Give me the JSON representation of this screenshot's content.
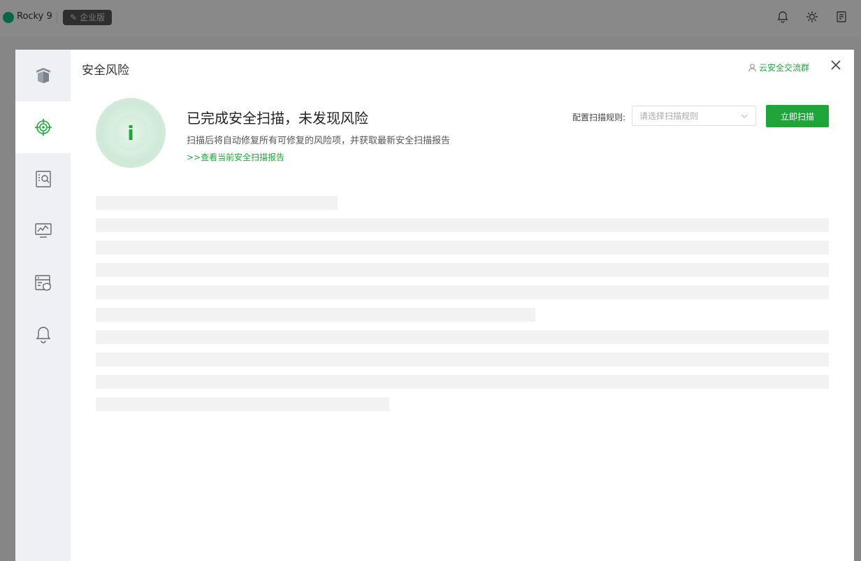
{
  "header": {
    "os_name": "Rocky 9",
    "edition": "企业版"
  },
  "modal": {
    "title": "安全风险",
    "community_link": "云安全交流群",
    "status_icon": "i",
    "status_title": "已完成安全扫描，未发现风险",
    "status_desc": "扫描后将自动修复所有可修复的风险项，并获取最新安全扫描报告",
    "report_link": ">>查看当前安全扫描报告",
    "rule_label": "配置扫描规则:",
    "rule_placeholder": "请选择扫描规则",
    "scan_button": "立即扫描"
  },
  "side_nav": [
    {
      "icon": "shield-box-icon",
      "active": false
    },
    {
      "icon": "target-scan-icon",
      "active": true
    },
    {
      "icon": "document-search-icon",
      "active": false
    },
    {
      "icon": "monitor-pulse-icon",
      "active": false
    },
    {
      "icon": "server-shield-icon",
      "active": false
    },
    {
      "icon": "bell-icon",
      "active": false
    }
  ],
  "colors": {
    "accent": "#20a53a",
    "sidebar_bg": "#eef0f5",
    "skeleton": "#f2f2f2"
  }
}
